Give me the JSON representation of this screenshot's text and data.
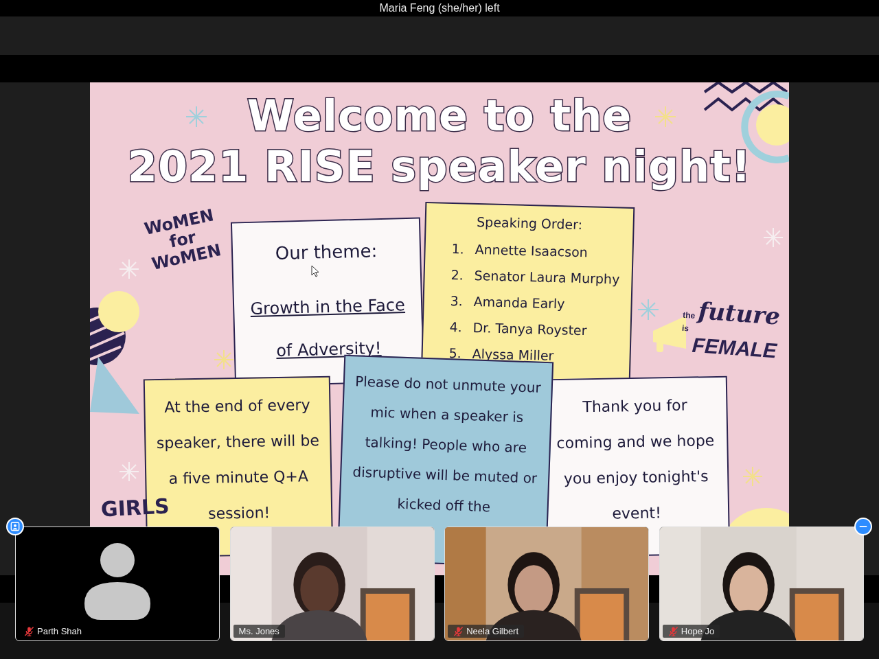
{
  "meeting": {
    "banner": "Maria Feng (she/her) left"
  },
  "slide": {
    "title_lines": [
      "Welcome to the",
      "2021 RISE speaker night!"
    ],
    "logos": [
      {
        "kind": "women",
        "text": "WoMEN for WoMEN"
      },
      {
        "kind": "future",
        "small": "the",
        "main": "future",
        "tail": "is",
        "big": "FEMALE"
      },
      {
        "kind": "girls",
        "text": "GIRLS"
      }
    ],
    "notes": [
      {
        "kind": "theme",
        "color": "#fbf8f8",
        "heading": "Our theme:",
        "text": "Growth in the Face of Adversity!"
      },
      {
        "kind": "list",
        "color": "#fbeea0",
        "heading": "Speaking Order:",
        "items": [
          {
            "number": "1.",
            "name": "Annette Isaacson"
          },
          {
            "number": "2.",
            "name": "Senator Laura Murphy"
          },
          {
            "number": "3.",
            "name": "Amanda Early"
          },
          {
            "number": "4.",
            "name": "Dr. Tanya Royster"
          },
          {
            "number": "5.",
            "name": "Alyssa Miller"
          }
        ]
      },
      {
        "kind": "text",
        "color": "#fbeea0",
        "text": "At the end of every speaker, there will be a five minute Q+A session!"
      },
      {
        "kind": "text",
        "color": "#9fc9da",
        "text": "Please do not unmute your mic when a speaker is talking! People who are disruptive will be muted or kicked off the"
      },
      {
        "kind": "text",
        "color": "#fbf8f8",
        "text": "Thank you for coming and we hope you enjoy tonight's event!"
      }
    ]
  },
  "participants": [
    {
      "name": "Parth Shah",
      "video": false,
      "muted": true
    },
    {
      "name": "Ms. Jones",
      "video": true,
      "muted": false
    },
    {
      "name": "Neela Gilbert",
      "video": true,
      "muted": true
    },
    {
      "name": "Hope Jo",
      "video": true,
      "muted": true
    }
  ]
}
